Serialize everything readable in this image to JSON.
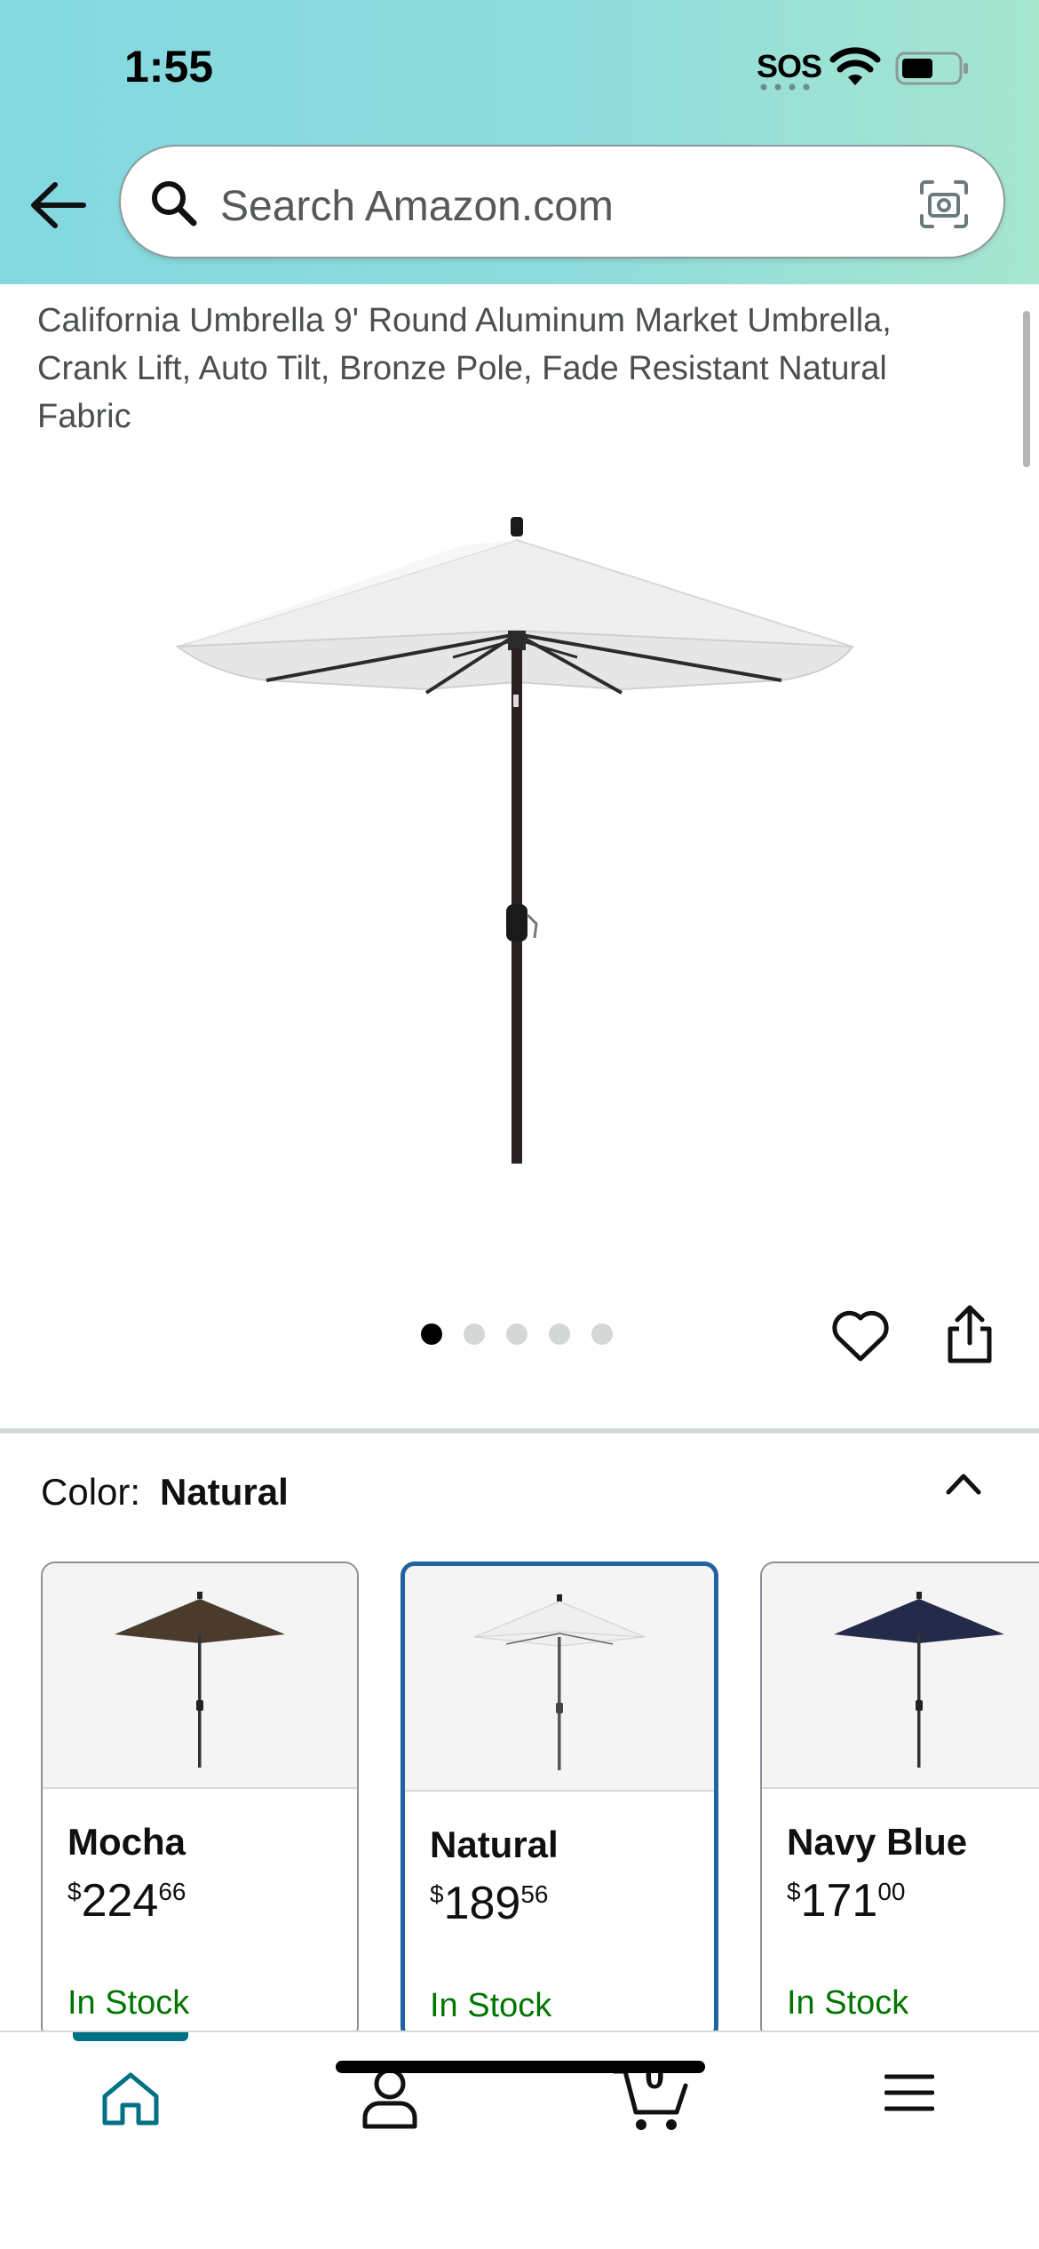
{
  "status_bar": {
    "time": "1:55",
    "sos": "SOS"
  },
  "search": {
    "placeholder": "Search Amazon.com"
  },
  "product": {
    "title": "California Umbrella 9' Round Aluminum Market Umbrella, Crank Lift, Auto Tilt, Bronze Pole, Fade Resistant Natural Fabric",
    "image_count": 5,
    "active_image": 1
  },
  "color_section": {
    "label": "Color:",
    "selected": "Natural"
  },
  "swatches": [
    {
      "name": "Mocha",
      "currency": "$",
      "price_whole": "224",
      "price_fraction": "66",
      "stock": "In Stock",
      "canopy_color": "#4a3b2c"
    },
    {
      "name": "Natural",
      "currency": "$",
      "price_whole": "189",
      "price_fraction": "56",
      "stock": "In Stock",
      "canopy_color": "#efefef"
    },
    {
      "name": "Navy Blue",
      "currency": "$",
      "price_whole": "171",
      "price_fraction": "00",
      "stock": "In Stock",
      "canopy_color": "#232a4a"
    }
  ],
  "bottom_nav": {
    "cart_count": "0",
    "items": [
      "home-icon",
      "profile-icon",
      "cart-icon",
      "menu-icon"
    ]
  },
  "colors": {
    "header_start": "#83d8e0",
    "header_end": "#a6e6cf",
    "accent": "#007185",
    "selected_border": "#2162a1",
    "in_stock": "#007600"
  }
}
